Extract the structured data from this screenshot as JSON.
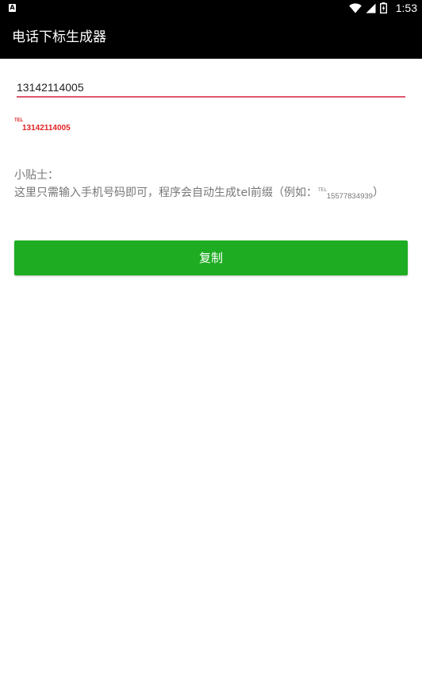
{
  "status_bar": {
    "time": "1:53",
    "left_icon": "A",
    "icons": [
      "wifi-icon",
      "signal-icon",
      "battery-icon"
    ]
  },
  "app_bar": {
    "title": "电话下标生成器"
  },
  "phone_input": {
    "value": "13142114005"
  },
  "preview": {
    "prefix": "TEL",
    "number": "13142114005"
  },
  "tip": {
    "title": "小贴士：",
    "body_text": "这里只需输入手机号码即可，程序会自动生成tel前缀（例如：",
    "example_prefix": "TEL",
    "example_number": "15577834939",
    "body_close": "）"
  },
  "copy_button": {
    "label": "复制"
  },
  "colors": {
    "status_bar": "#000000",
    "app_bar": "#000000",
    "accent_green": "#1eac22",
    "input_underline": "#e0576f",
    "preview_red": "#e02424",
    "tip_text": "#777777"
  }
}
